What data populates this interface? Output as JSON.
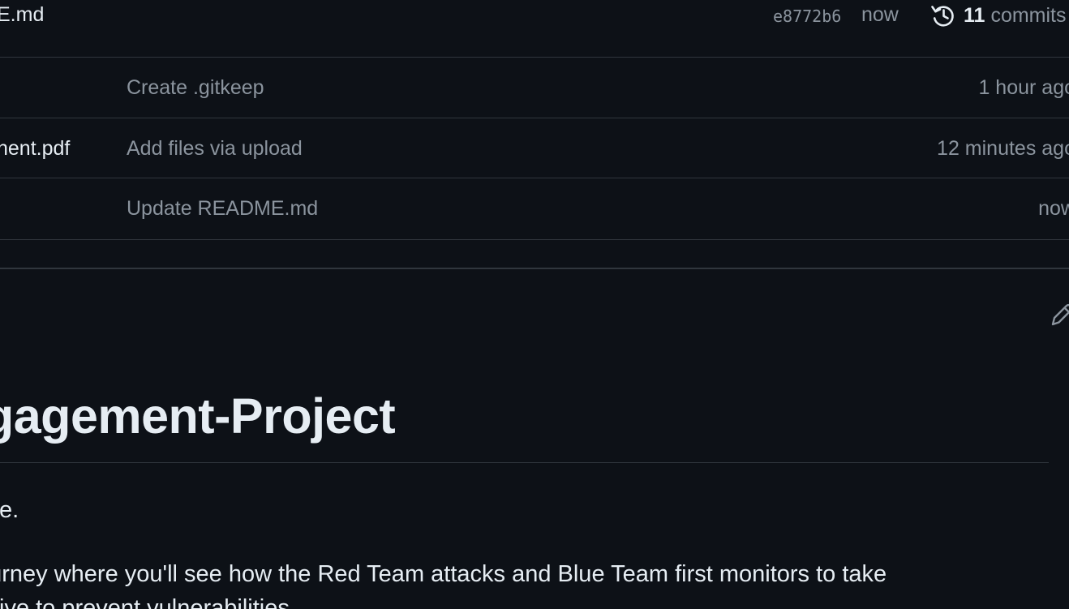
{
  "latest_commit": {
    "filename": "E.md",
    "hash": "e8772b6",
    "time": "now",
    "history_count": "11",
    "history_label": "commits"
  },
  "files": [
    {
      "name": "",
      "message": "Create .gitkeep",
      "age": "1 hour ago"
    },
    {
      "name": "nent.pdf",
      "message": "Add files via upload",
      "age": "12 minutes ago"
    },
    {
      "name": "",
      "message": "Update README.md",
      "age": "now"
    }
  ],
  "readme": {
    "title": "gagement-Project",
    "line_1": "tice.",
    "line_2": "ourney where you'll see how the Red Team attacks and Blue Team first monitors to take",
    "line_3": "sitive to prevent vulnerabilities."
  },
  "icons": {
    "history": "history-icon",
    "edit": "pencil-icon"
  },
  "colors": {
    "background": "#0d1117",
    "border": "#30363d",
    "text_primary": "#e6edf3",
    "text_muted": "#8b949e"
  }
}
